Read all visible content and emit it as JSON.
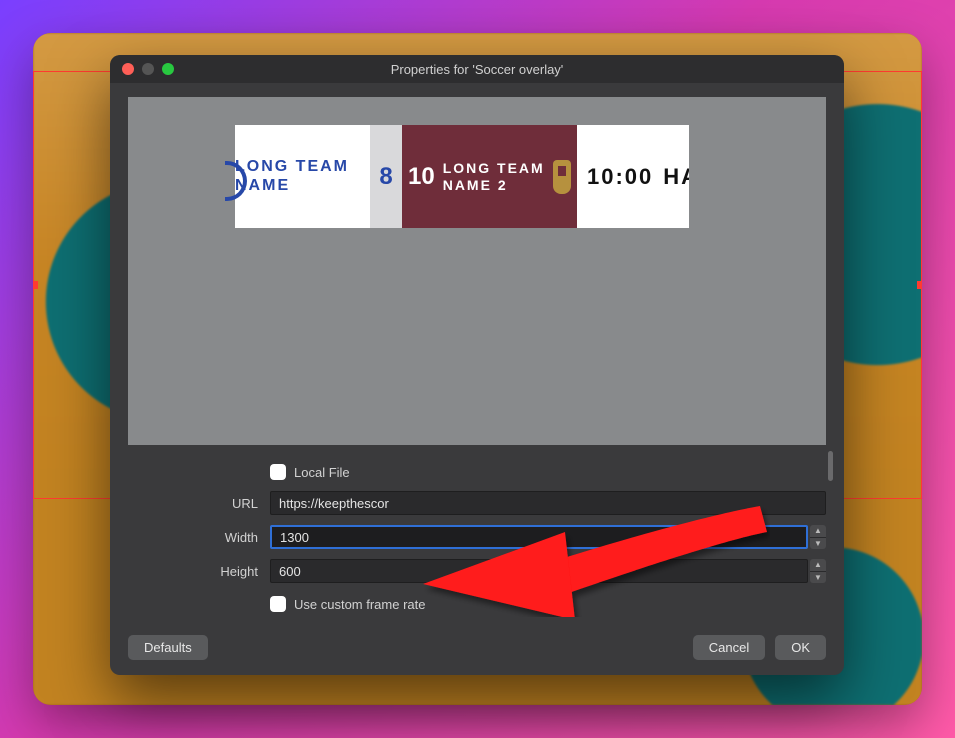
{
  "window": {
    "title": "Properties for 'Soccer overlay'"
  },
  "scoreboard": {
    "team1_name": "LONG TEAM NAME",
    "team1_score": "8",
    "team2_score": "10",
    "team2_name": "LONG TEAM NAME 2",
    "clock": "10:00",
    "period": "HALF"
  },
  "form": {
    "local_file_label": "Local File",
    "url_label": "URL",
    "url_value": "https://keepthescor",
    "width_label": "Width",
    "width_value": "1300",
    "height_label": "Height",
    "height_value": "600",
    "custom_fps_label": "Use custom frame rate"
  },
  "buttons": {
    "defaults": "Defaults",
    "cancel": "Cancel",
    "ok": "OK"
  }
}
